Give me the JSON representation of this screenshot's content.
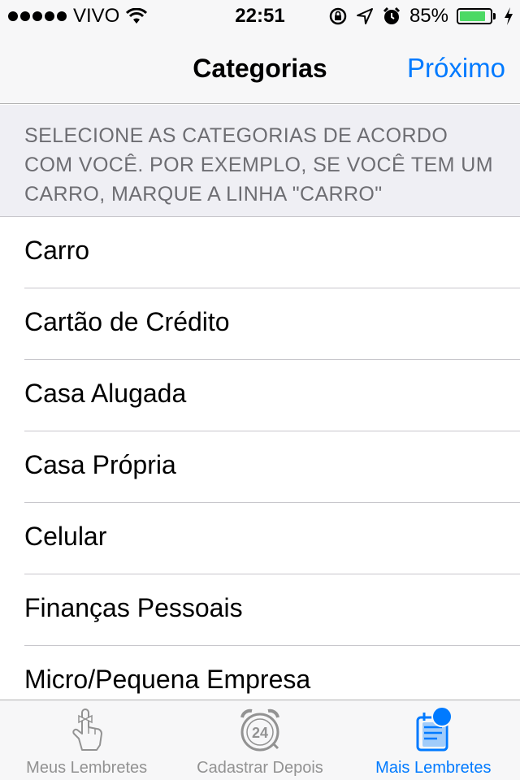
{
  "status_bar": {
    "carrier": "VIVO",
    "time": "22:51",
    "battery_percent": "85%",
    "battery_level": 0.85,
    "icons": [
      "signal-dots-icon",
      "wifi-icon",
      "rotation-lock-icon",
      "location-arrow-icon",
      "alarm-icon",
      "battery-icon",
      "charging-bolt-icon"
    ]
  },
  "nav": {
    "title": "Categorias",
    "next_label": "Próximo"
  },
  "hint": {
    "text": "SELECIONE AS CATEGORIAS DE ACORDO COM VOCÊ. POR EXEMPLO, SE VOCÊ TEM UM CARRO, MARQUE A LINHA \"CARRO\""
  },
  "categories": [
    "Carro",
    "Cartão de Crédito",
    "Casa Alugada",
    "Casa Própria",
    "Celular",
    "Finanças Pessoais",
    "Micro/Pequena Empresa"
  ],
  "tabs": [
    {
      "label": "Meus Lembretes",
      "icon": "finger-ribbon-icon"
    },
    {
      "label": "Cadastrar Depois",
      "icon": "clock-24-icon"
    },
    {
      "label": "Mais Lembretes",
      "icon": "notepad-icon"
    }
  ],
  "colors": {
    "accent": "#007aff",
    "battery_fill": "#4cd964",
    "inactive_tab": "#929292"
  }
}
